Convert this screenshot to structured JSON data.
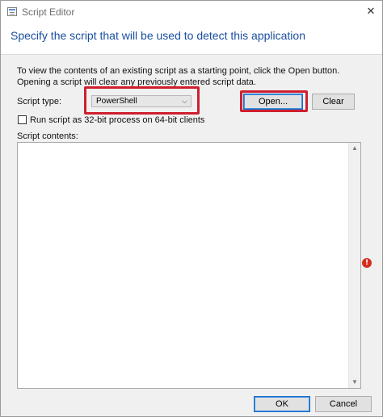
{
  "window": {
    "title": "Script Editor",
    "close_glyph": "✕"
  },
  "heading": "Specify the script that will be used to detect this application",
  "intro_text": "To view the contents of an existing script as a starting point, click the Open button. Opening a script will clear any previously entered script data.",
  "script_type": {
    "label": "Script type:",
    "selected": "PowerShell",
    "options": [
      "PowerShell"
    ]
  },
  "buttons": {
    "open": "Open...",
    "clear": "Clear",
    "ok": "OK",
    "cancel": "Cancel"
  },
  "checkbox": {
    "label": "Run script as 32-bit process on 64-bit clients",
    "checked": false
  },
  "script_contents": {
    "label": "Script contents:",
    "value": ""
  },
  "icons": {
    "title_icon": "script-editor-icon",
    "validation": "error-icon",
    "validation_glyph": "!",
    "combo_arrow_glyph": "⌵"
  },
  "colors": {
    "heading": "#1a4fa0",
    "annotation_highlight": "#cf1f2e",
    "error": "#d62d20"
  }
}
